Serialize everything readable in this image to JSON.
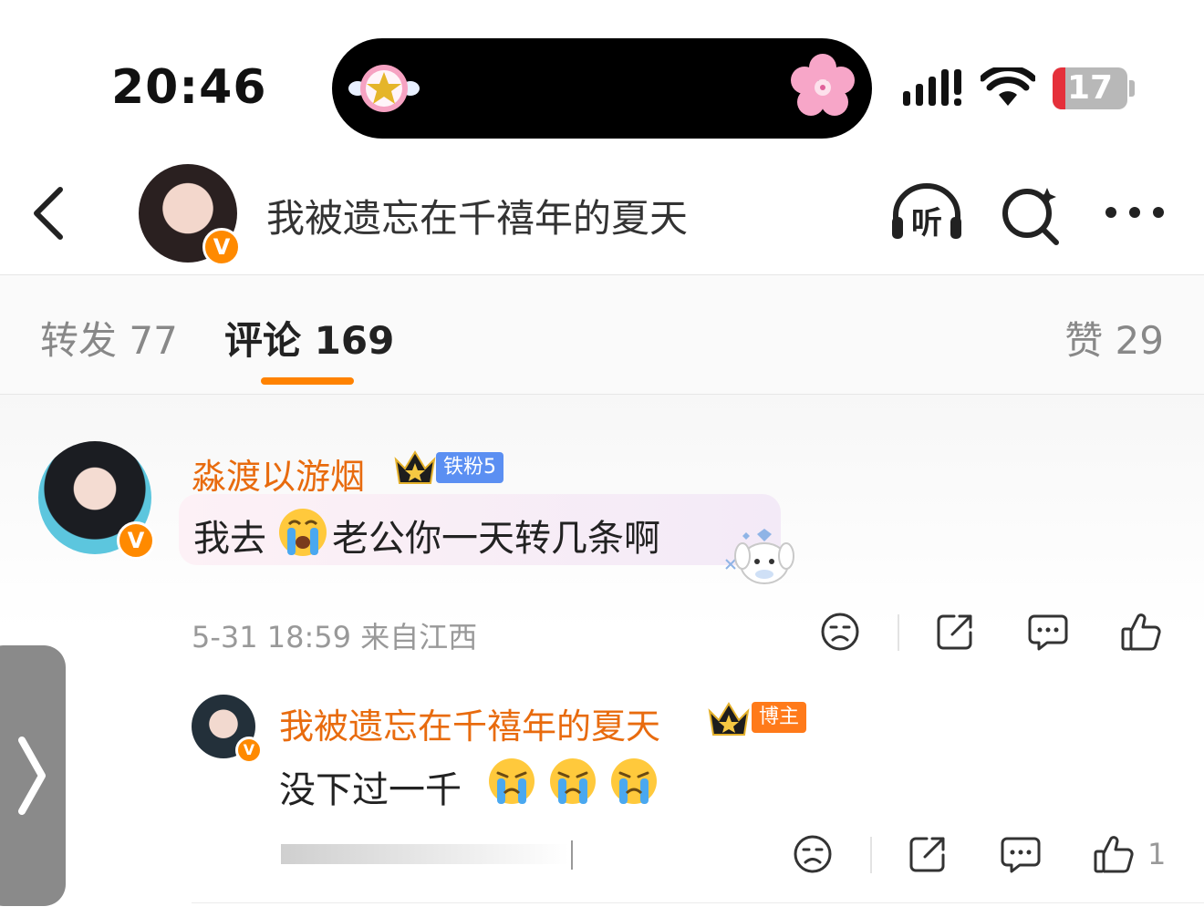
{
  "status_bar": {
    "time": "20:46",
    "battery": "17",
    "battery_level": 0.17,
    "icons": [
      "signal-icon",
      "wifi-icon",
      "battery-icon"
    ]
  },
  "header": {
    "title": "我被遗忘在千禧年的夏天",
    "icons": [
      "back-icon",
      "listen-icon",
      "search-icon",
      "more-icon"
    ],
    "listen_glyph": "听"
  },
  "tabs": [
    {
      "label": "转发 77"
    },
    {
      "label": "评论 169",
      "active": true
    },
    {
      "label": "赞 29"
    }
  ],
  "comments": [
    {
      "user": "淼渡以游烟",
      "fan_badge": "铁粉5",
      "verified": "V",
      "text_a": "我去",
      "text_b": "老公你一天转几条啊",
      "meta": "5-31 18:59  来自江西",
      "reply": {
        "user": "我被遗忘在千禧年的夏天",
        "role_badge": "博主",
        "text": "没下过一千",
        "like_count": "1"
      }
    }
  ],
  "colors": {
    "accent": "#ff8200",
    "username": "#e86b0e",
    "fan_badge": "#5b8ff2",
    "host_badge": "#ff7a1a"
  }
}
